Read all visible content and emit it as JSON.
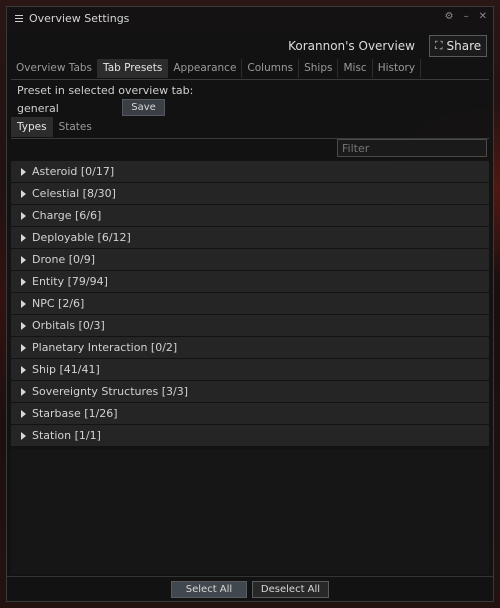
{
  "window": {
    "title": "Overview Settings",
    "overview_name": "Korannon's Overview",
    "share_label": "Share"
  },
  "tabs": [
    "Overview Tabs",
    "Tab Presets",
    "Appearance",
    "Columns",
    "Ships",
    "Misc",
    "History"
  ],
  "preset": {
    "label": "Preset in selected overview tab:",
    "value": "general",
    "save_label": "Save"
  },
  "subtabs": [
    "Types",
    "States"
  ],
  "filter": {
    "placeholder": "Filter"
  },
  "groups": [
    {
      "label": "Asteroid [0/17]"
    },
    {
      "label": "Celestial [8/30]"
    },
    {
      "label": "Charge [6/6]"
    },
    {
      "label": "Deployable [6/12]"
    },
    {
      "label": "Drone [0/9]"
    },
    {
      "label": "Entity [79/94]"
    },
    {
      "label": "NPC [2/6]"
    },
    {
      "label": "Orbitals [0/3]"
    },
    {
      "label": "Planetary Interaction [0/2]"
    },
    {
      "label": "Ship [41/41]"
    },
    {
      "label": "Sovereignty Structures [3/3]"
    },
    {
      "label": "Starbase [1/26]"
    },
    {
      "label": "Station [1/1]"
    }
  ],
  "footer": {
    "select_all": "Select All",
    "deselect_all": "Deselect All"
  },
  "colors": {
    "window_bg": "#121212",
    "row_bg": "#252525",
    "accent": "#41474e"
  }
}
